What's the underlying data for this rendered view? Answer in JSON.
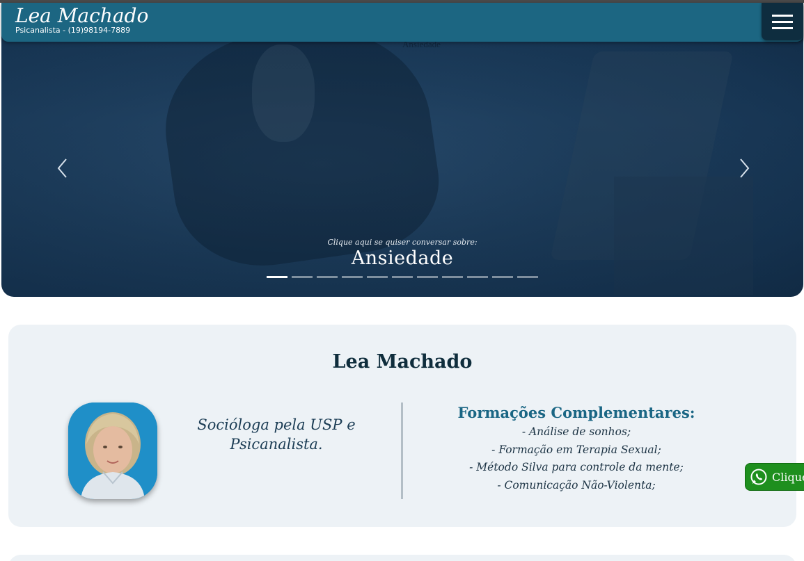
{
  "header": {
    "brand": "Lea Machado",
    "subtitle": "Psicanalista - (19)98194-7889",
    "menu_icon": "hamburger-icon",
    "color": "#1c6682"
  },
  "carousel": {
    "ghost_text": "Ansiedade",
    "caption_kicker": "Clique aqui se quiser conversar sobre:",
    "caption_title": "Ansiedade",
    "prev_icon": "chevron-left-icon",
    "next_icon": "chevron-right-icon",
    "slide_count": 11,
    "active_slide": 1
  },
  "about": {
    "title": "Lea Machado",
    "bio": "Socióloga pela USP e Psicanalista.",
    "formations_title": "Formações Complementares:",
    "formations": [
      "- Análise de sonhos;",
      "- Formação em Terapia Sexual;",
      "- Método Silva para controle da mente;",
      "- Comunicação Não-Violenta;"
    ]
  },
  "whatsapp": {
    "label": "Clique",
    "icon": "whatsapp-icon",
    "color": "#1e8f1e"
  }
}
